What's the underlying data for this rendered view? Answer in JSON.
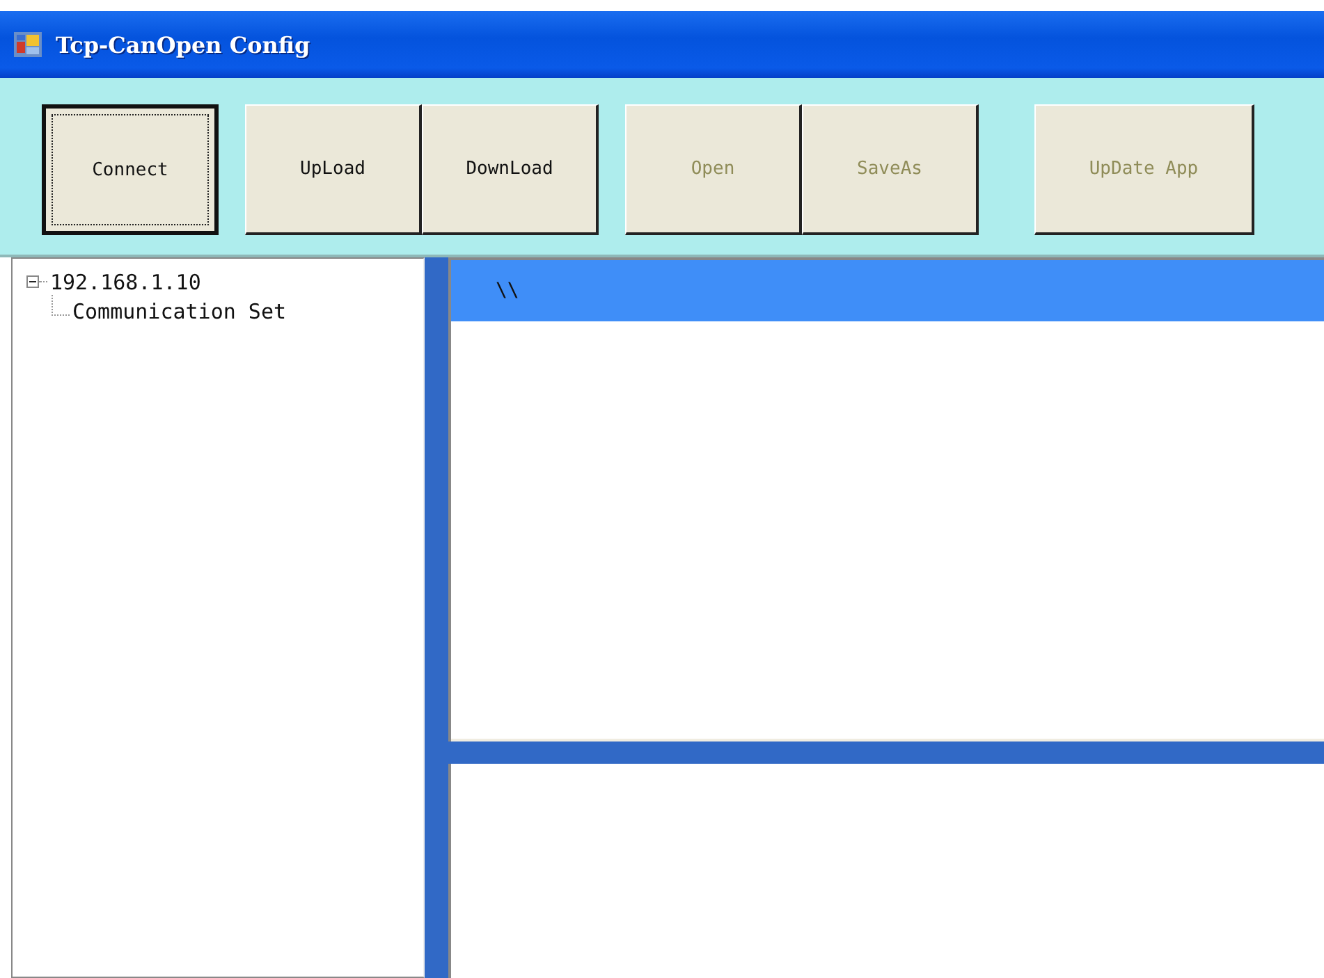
{
  "window": {
    "title": "Tcp-CanOpen Config"
  },
  "toolbar": [
    {
      "label": "Connect",
      "focused": true,
      "disabled": false,
      "gap_before": false
    },
    {
      "label": "UpLoad",
      "focused": false,
      "disabled": false,
      "gap_before": true
    },
    {
      "label": "DownLoad",
      "focused": false,
      "disabled": false,
      "gap_before": false
    },
    {
      "label": "Open",
      "focused": false,
      "disabled": true,
      "gap_before": true
    },
    {
      "label": "SaveAs",
      "focused": false,
      "disabled": true,
      "gap_before": false
    },
    {
      "label": "UpDate App",
      "focused": false,
      "disabled": true,
      "gap_before": true
    }
  ],
  "tree": [
    {
      "label": "192.168.1.10",
      "expanded": true,
      "children": [
        {
          "label": "Communication Set"
        }
      ]
    }
  ],
  "content": {
    "header": "\\\\"
  }
}
